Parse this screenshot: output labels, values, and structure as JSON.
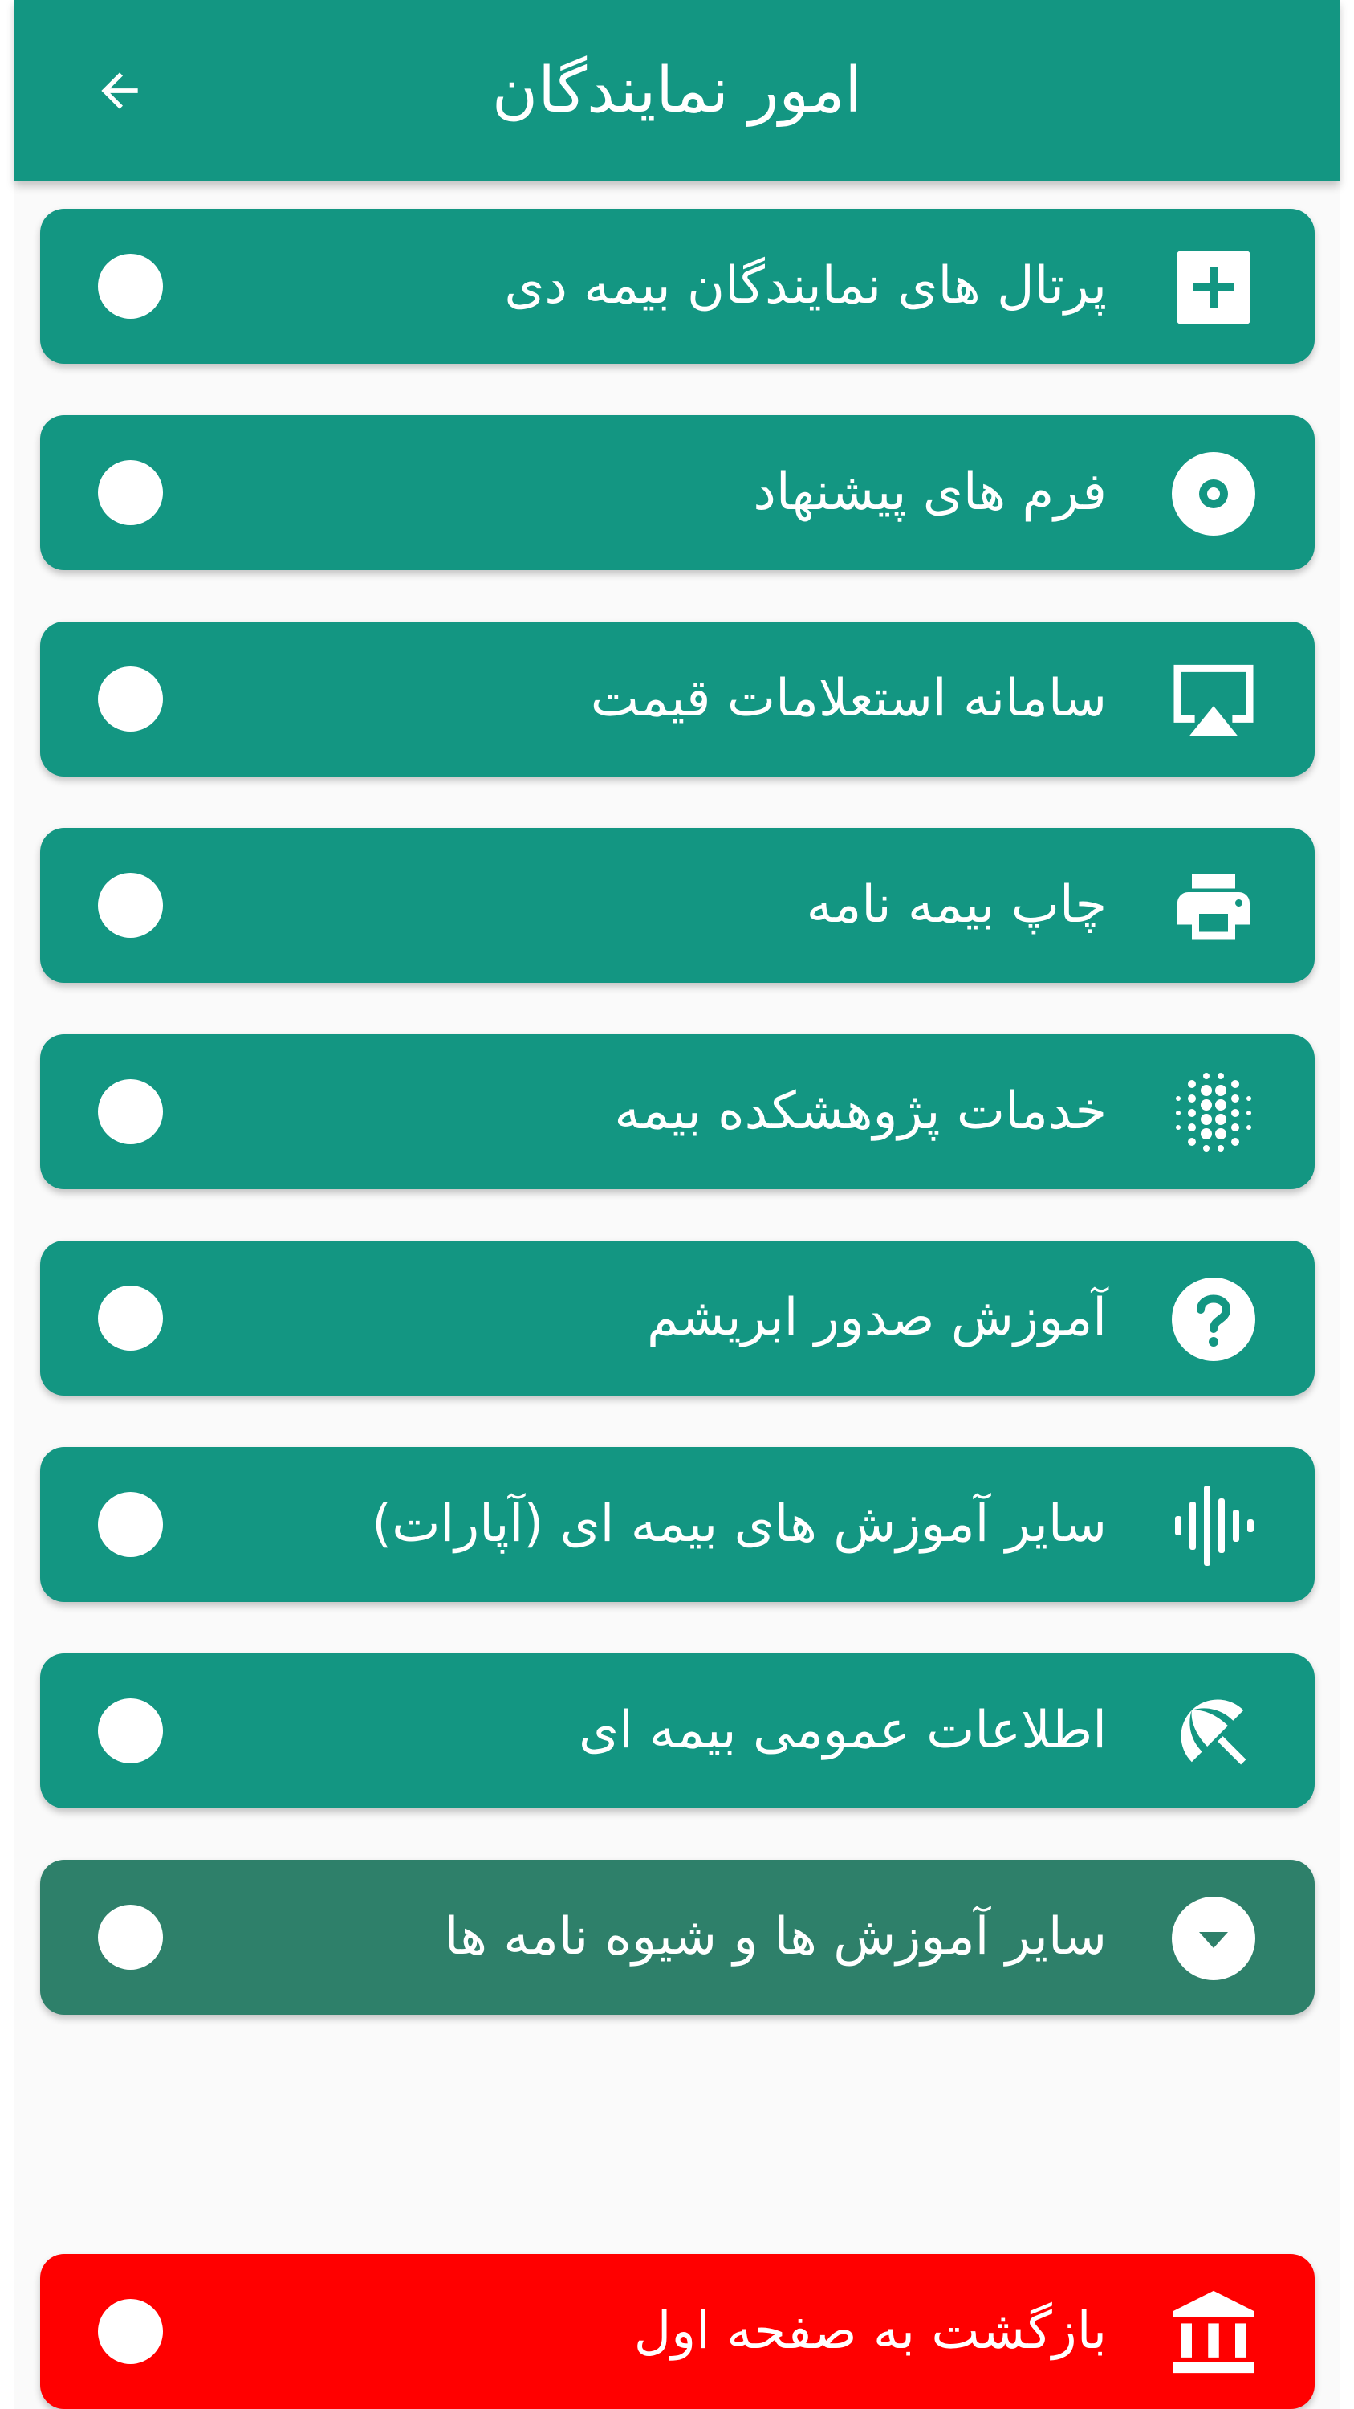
{
  "header": {
    "title": "امور نمایندگان",
    "back_icon": "arrow-left-icon"
  },
  "colors": {
    "primary": "#139682",
    "dark_item": "#2e806a",
    "danger": "#ff0000",
    "background": "#fafafa"
  },
  "menu": {
    "items": [
      {
        "label": "پرتال های نمایندگان بیمه دی",
        "icon": "plus-box-icon"
      },
      {
        "label": "فرم های پیشنهاد",
        "icon": "disc-icon"
      },
      {
        "label": "سامانه استعلامات قیمت",
        "icon": "airplay-icon"
      },
      {
        "label": "چاپ بیمه نامه",
        "icon": "printer-icon"
      },
      {
        "label": "خدمات پژوهشکده بیمه",
        "icon": "dot-grid-icon"
      },
      {
        "label": "آموزش صدور ابریشم",
        "icon": "help-circle-icon"
      },
      {
        "label": "سایر آموزش های بیمه ای (آپارات)",
        "icon": "audio-wave-icon"
      },
      {
        "label": "اطلاعات عمومی بیمه ای",
        "icon": "beach-umbrella-icon"
      },
      {
        "label": "سایر آموزش ها و شیوه نامه ها",
        "icon": "chevron-down-circle-icon"
      }
    ]
  },
  "footer": {
    "home_label": "بازگشت به صفحه اول",
    "icon": "bank-icon"
  }
}
